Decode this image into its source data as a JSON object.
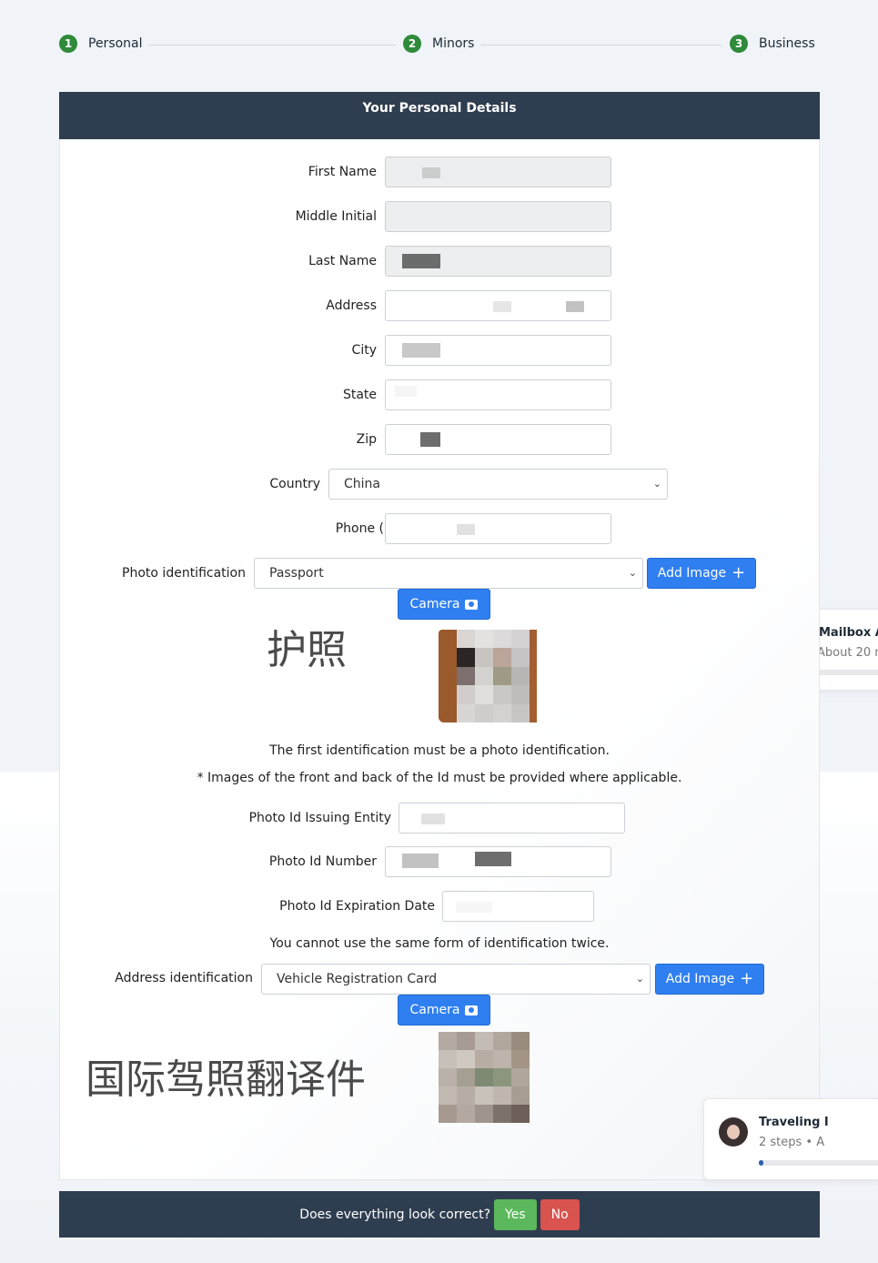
{
  "stepper": [
    {
      "num": "1",
      "label": "Personal"
    },
    {
      "num": "2",
      "label": "Minors"
    },
    {
      "num": "3",
      "label": "Business"
    }
  ],
  "form": {
    "title": "Your Personal Details",
    "first_name_label": "First Name",
    "middle_initial_label": "Middle Initial",
    "last_name_label": "Last Name",
    "address_label": "Address",
    "city_label": "City",
    "state_label": "State",
    "zip_label": "Zip",
    "country_label": "Country",
    "country_value": "China",
    "phone_label": "Phone (",
    "photo_id_label": "Photo identification",
    "photo_id_value": "Passport",
    "add_image_label": "Add Image",
    "camera_label": "Camera",
    "passport_caption": "护照",
    "note_first_id": "The first identification must be a photo identification.",
    "note_front_back": "* Images of the front and back of the Id must be provided where applicable.",
    "photo_id_issuing_label": "Photo Id Issuing Entity",
    "photo_id_number_label": "Photo Id Number",
    "photo_id_expiration_label": "Photo Id Expiration Date",
    "note_same_form": "You cannot use the same form of identification twice.",
    "address_id_label": "Address identification",
    "address_id_value": "Vehicle Registration Card",
    "address_caption": "国际驾照翻译件"
  },
  "footer": {
    "question": "Does everything look correct?",
    "yes_label": "Yes",
    "no_label": "No"
  },
  "side_cards": {
    "mailbox_title": "Mailbox A",
    "mailbox_sub": "About 20 m",
    "travel_title": "Traveling I",
    "travel_sub": "2 steps • A"
  },
  "colors": {
    "header_bg": "#2e3d4f",
    "primary_blue": "#2f7ff0",
    "success_green": "#5cb85c",
    "danger_red": "#d9534f",
    "step_green": "#2f8a3a"
  }
}
